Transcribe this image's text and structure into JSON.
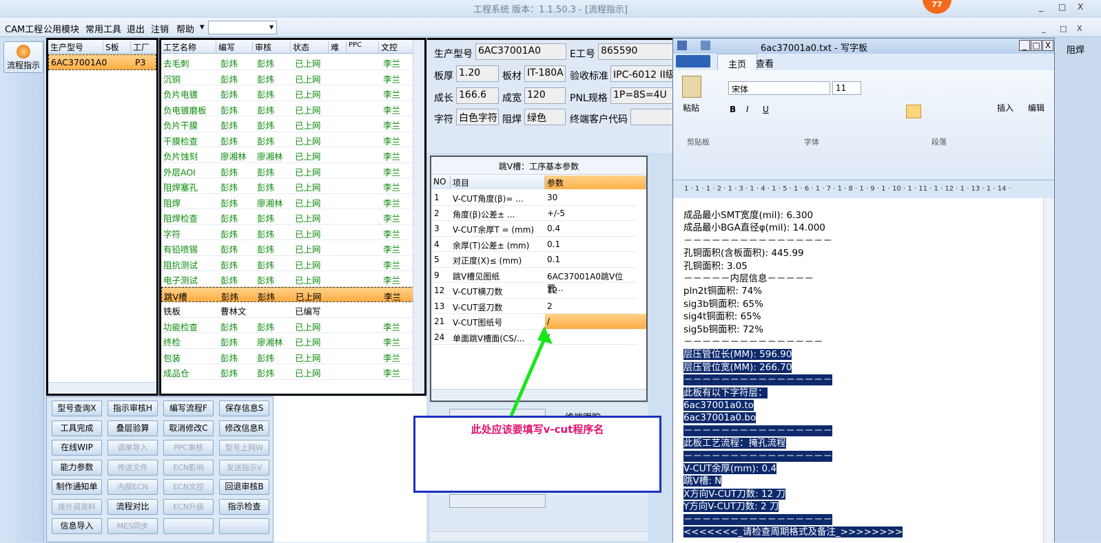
{
  "app": {
    "title": "工程系统  版本：1.1.50.3 - [流程指示]",
    "badge": "77",
    "window_buttons": [
      "_",
      "□",
      "X"
    ],
    "mdi_buttons": [
      "_",
      "□",
      "X"
    ]
  },
  "menu": {
    "items": [
      "CAM工程",
      "公用模块",
      "常用工具",
      "退出",
      "注销",
      "帮助"
    ],
    "dropdown_arrow": "▾"
  },
  "nav": {
    "button": "流程指示"
  },
  "grid1": {
    "headers": [
      "生产型号",
      "S板",
      "工厂"
    ],
    "rows": [
      [
        "6AC37001A0",
        "",
        "P3"
      ]
    ]
  },
  "grid2": {
    "headers": [
      "工艺名称",
      "编写",
      "审核",
      "状态",
      "难",
      "PPC",
      "文控"
    ],
    "rows": [
      [
        "去毛刺",
        "彭炜",
        "彭炜",
        "已上网",
        "",
        "",
        "李兰"
      ],
      [
        "沉铜",
        "彭炜",
        "彭炜",
        "已上网",
        "",
        "",
        "李兰"
      ],
      [
        "负片电镀",
        "彭炜",
        "彭炜",
        "已上网",
        "",
        "",
        "李兰"
      ],
      [
        "负电镀磨板",
        "彭炜",
        "彭炜",
        "已上网",
        "",
        "",
        "李兰"
      ],
      [
        "负片干膜",
        "彭炜",
        "彭炜",
        "已上网",
        "",
        "",
        "李兰"
      ],
      [
        "干膜检查",
        "彭炜",
        "彭炜",
        "已上网",
        "",
        "",
        "李兰"
      ],
      [
        "负片蚀刻",
        "廖湘林",
        "廖湘林",
        "已上网",
        "",
        "",
        "李兰"
      ],
      [
        "外层AOI",
        "彭炜",
        "彭炜",
        "已上网",
        "",
        "",
        "李兰"
      ],
      [
        "阻焊塞孔",
        "彭炜",
        "彭炜",
        "已上网",
        "",
        "",
        "李兰"
      ],
      [
        "阻焊",
        "彭炜",
        "廖湘林",
        "已上网",
        "",
        "",
        "李兰"
      ],
      [
        "阻焊检查",
        "彭炜",
        "彭炜",
        "已上网",
        "",
        "",
        "李兰"
      ],
      [
        "字符",
        "彭炜",
        "彭炜",
        "已上网",
        "",
        "",
        "李兰"
      ],
      [
        "有铅喷锡",
        "彭炜",
        "彭炜",
        "已上网",
        "",
        "",
        "李兰"
      ],
      [
        "阻抗测试",
        "彭炜",
        "彭炜",
        "已上网",
        "",
        "",
        "李兰"
      ],
      [
        "电子测试",
        "彭炜",
        "彭炜",
        "已上网",
        "",
        "",
        "李兰"
      ],
      [
        "跳V槽",
        "彭炜",
        "彭炜",
        "已上网",
        "",
        "",
        "李兰"
      ],
      [
        "铣板",
        "曹林文",
        "",
        "已编写",
        "",
        "",
        ""
      ],
      [
        "功能检查",
        "彭炜",
        "彭炜",
        "已上网",
        "",
        "",
        "李兰"
      ],
      [
        "终检",
        "彭炜",
        "廖湘林",
        "已上网",
        "",
        "",
        "李兰"
      ],
      [
        "包装",
        "彭炜",
        "彭炜",
        "已上网",
        "",
        "",
        "李兰"
      ],
      [
        "成品仓",
        "彭炜",
        "彭炜",
        "已上网",
        "",
        "",
        "李兰"
      ]
    ],
    "selected_index": 15,
    "black_index": 16
  },
  "buttons": [
    [
      "型号查询X",
      "指示审核H",
      "编写流程F",
      "保存信息S"
    ],
    [
      "工具完成",
      "叠层验算",
      "取消修改C",
      "修改信息R"
    ],
    [
      "在线WIP",
      "调单导入",
      "PPC审核",
      "型号上网W"
    ],
    [
      "能力参数",
      "传送文件",
      "ECN影响",
      "发送指示V"
    ],
    [
      "制作通知单",
      "内部ECN",
      "ECN文控",
      "回退审核B"
    ],
    [
      "接外调资料",
      "流程对比",
      "ECN升级",
      "指示检查"
    ],
    [
      "信息导入",
      "MES同步",
      "",
      ""
    ]
  ],
  "buttons_disabled": [
    [
      0,
      0,
      0,
      0
    ],
    [
      0,
      0,
      0,
      0
    ],
    [
      0,
      1,
      1,
      1
    ],
    [
      0,
      1,
      1,
      1
    ],
    [
      0,
      1,
      1,
      0
    ],
    [
      1,
      0,
      1,
      0
    ],
    [
      0,
      1,
      1,
      1
    ]
  ],
  "info": {
    "prod_model_label": "生产型号",
    "prod_model": "6AC37001A0",
    "e_no_label": "E工号",
    "e_no": "865590",
    "thickness_label": "板厚",
    "thickness": "1.20",
    "material_label": "板材",
    "material": "IT-180A",
    "standard_label": "验收标准",
    "standard": "IPC-6012 II级",
    "length_label": "成长",
    "length": "166.6",
    "width_label": "成宽",
    "width": "120",
    "pnl_label": "PNL规格",
    "pnl": "1P=8S=4U",
    "char_label": "字符",
    "char": "白色字符",
    "mask_label": "阻焊",
    "mask": "绿色",
    "customer_label": "终端客户代码",
    "customer": ""
  },
  "params": {
    "caption": "跳V槽：工序基本参数",
    "headers": [
      "NO",
      "项目",
      "参数"
    ],
    "rows": [
      [
        "1",
        "V-CUT角度(β)=  ...",
        "30"
      ],
      [
        "2",
        "角度(β)公差±  ...",
        "+/-5"
      ],
      [
        "3",
        "V-CUT余厚T =  (mm)",
        "0.4"
      ],
      [
        "4",
        "余厚(T)公差±  (mm)",
        "0.1"
      ],
      [
        "5",
        "对正度(X)≤ (mm)",
        "0.1"
      ],
      [
        "9",
        "跳V槽见图纸",
        "6AC37001A0跳V位置..."
      ],
      [
        "12",
        "V-CUT横刀数",
        "12"
      ],
      [
        "13",
        "V-CUT竖刀数",
        "2"
      ],
      [
        "21",
        "V-CUT图纸号",
        "/"
      ],
      [
        "24",
        "单面跳V槽面(CS/...",
        "/"
      ]
    ],
    "selected_index": 8
  },
  "below_panel": {
    "label": "终端跟踪"
  },
  "annotation": {
    "text": "此处应该要填写v-cut程序名",
    "color": "#e0126c"
  },
  "wordpad": {
    "title": "6ac37001a0.txt - 写字板",
    "tabs": [
      "主页",
      "查看"
    ],
    "groups": [
      "剪贴板",
      "字体",
      "段落"
    ],
    "paste": "粘贴",
    "insert": "插入",
    "edit": "编辑",
    "font": "宋体",
    "size": "11",
    "ruler": "1 · 1 · 1 · 2 · 1 · 3 · 1 · 4 · 1 · 5 · 1 · 6 · 1 · 7 · 1 · 8 · 1 · 9 · 1 · 10 · 1 · 11 · 1 · 12 · 1 · 13 · 1 · 14 ·",
    "lines": [
      {
        "t": "成品最小SMT宽度(mil): 6.300",
        "h": false
      },
      {
        "t": "成品最小BGA直径φ(mil): 14.000",
        "h": false
      },
      {
        "t": "－－－－－－－－－－－－－－－－",
        "h": false
      },
      {
        "t": "孔铜面积(含板面积): 445.99",
        "h": false
      },
      {
        "t": "孔铜面积: 3.05",
        "h": false
      },
      {
        "t": "－－－－－内层信息－－－－－",
        "h": false
      },
      {
        "t": "pln2t铜面积: 74%",
        "h": false
      },
      {
        "t": "sig3b铜面积: 65%",
        "h": false
      },
      {
        "t": "sig4t铜面积: 65%",
        "h": false
      },
      {
        "t": "sig5b铜面积: 72%",
        "h": false
      },
      {
        "t": "－－－－－－－－－－－－－－－",
        "h": false
      },
      {
        "t": "层压管位长(MM): 596.90",
        "h": true
      },
      {
        "t": "层压管位宽(MM): 266.70",
        "h": true
      },
      {
        "t": "－－－－－－－－－－－－－－－－",
        "h": true
      },
      {
        "t": "此板有以下字符层：",
        "h": true
      },
      {
        "t": "6ac37001a0.to",
        "h": true
      },
      {
        "t": "6ac37001a0.bo",
        "h": true
      },
      {
        "t": "－－－－－－－－－－－－－－－－",
        "h": true
      },
      {
        "t": "此板工艺流程：掩孔流程",
        "h": true
      },
      {
        "t": "－－－－－－－－－－－－－－－－",
        "h": true
      },
      {
        "t": "V-CUT余厚(mm): 0.4",
        "h": true
      },
      {
        "t": "跳V槽: N",
        "h": true
      },
      {
        "t": "X方向V-CUT刀数: 12 刀",
        "h": true
      },
      {
        "t": "Y方向V-CUT刀数: 2 刀",
        "h": true
      },
      {
        "t": "－－－－－－－－－－－－－－－－",
        "h": true
      },
      {
        "t": "<<<<<<<_请检查周期格式及备注_>>>>>>>>",
        "h": true
      }
    ]
  },
  "right_edge": {
    "label": "阻焊"
  }
}
